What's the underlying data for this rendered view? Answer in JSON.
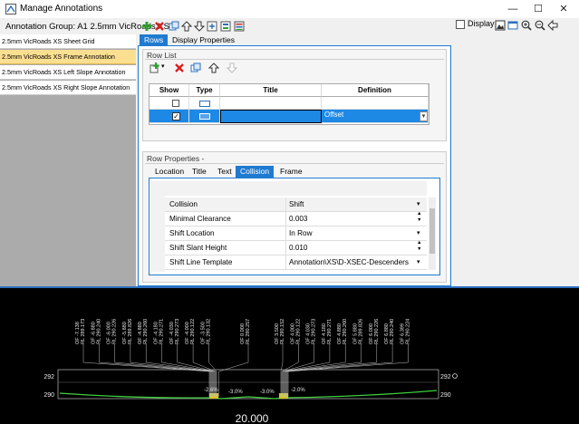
{
  "window": {
    "title": "Manage Annotations",
    "minimize": "—",
    "maximize": "☐",
    "close": "✕"
  },
  "toolbar": {
    "group_label": "Annotation Group: A1 2.5mm VicRoads XS"
  },
  "display": {
    "label": "Display"
  },
  "left_list": {
    "items": [
      {
        "label": "2.5mm VicRoads XS Sheet Grid",
        "selected": false
      },
      {
        "label": "2.5mm VicRoads XS Frame Annotation",
        "selected": true
      },
      {
        "label": "2.5mm VicRoads XS Left Slope Annotation",
        "selected": false
      },
      {
        "label": "2.5mm VicRoads XS Right Slope Annotation",
        "selected": false
      }
    ]
  },
  "tabs": [
    {
      "label": "Rows",
      "active": true
    },
    {
      "label": "Display Properties",
      "active": false
    }
  ],
  "row_list": {
    "title": "Row List",
    "columns": [
      "Show",
      "Type",
      "Title",
      "Definition"
    ],
    "rows": [
      {
        "show": false,
        "type": "empty",
        "title": "",
        "definition": ""
      },
      {
        "show": true,
        "type": "text",
        "title": "",
        "definition": "Offset",
        "selected": true
      }
    ]
  },
  "row_properties": {
    "title": "Row Properties -",
    "subtabs": [
      {
        "label": "Location",
        "active": false
      },
      {
        "label": "Title",
        "active": false
      },
      {
        "label": "Text",
        "active": false
      },
      {
        "label": "Collision",
        "active": true
      },
      {
        "label": "Frame",
        "active": false
      }
    ],
    "props": [
      {
        "name": "Collision",
        "value": "Shift",
        "control": "dropdown",
        "header": true
      },
      {
        "name": "Minimal Clearance",
        "value": "0.003",
        "control": "spin"
      },
      {
        "name": "Shift Location",
        "value": "In Row",
        "control": "dropdown"
      },
      {
        "name": "Shift Slant Height",
        "value": "0.010",
        "control": "spin"
      },
      {
        "name": "Shift Line Template",
        "value": "Annotation\\XS\\D-XSEC-Descenders",
        "control": "dropdown"
      }
    ]
  },
  "xsection": {
    "labels_left": [
      {
        "of": "OF -7.138",
        "rl": "RL 289.173"
      },
      {
        "of": "OF -6.880",
        "rl": "RL 290.240"
      },
      {
        "of": "OF -6.000",
        "rl": "RL 290.226"
      },
      {
        "of": "OF -5.880",
        "rl": "RL 289.826"
      },
      {
        "of": "OF -4.880",
        "rl": "RL 290.260"
      },
      {
        "of": "OF -4.180",
        "rl": "RL 290.271"
      },
      {
        "of": "OF -4.030",
        "rl": "RL 290.273"
      },
      {
        "of": "OF -4.000",
        "rl": "RL 290.122"
      },
      {
        "of": "OF -3.500",
        "rl": "RL 290.132"
      }
    ],
    "labels_center": [
      {
        "of": "OF 0.000",
        "rl": "RL 290.257"
      }
    ],
    "labels_right": [
      {
        "of": "OF 3.500",
        "rl": "RL 290.152"
      },
      {
        "of": "OF 4.000",
        "rl": "RL 290.122"
      },
      {
        "of": "OF 4.030",
        "rl": "RL 290.273"
      },
      {
        "of": "OF 4.180",
        "rl": "RL 290.271"
      },
      {
        "of": "OF 4.880",
        "rl": "RL 290.260"
      },
      {
        "of": "OF 5.880",
        "rl": "RL 289.826"
      },
      {
        "of": "OF 6.000",
        "rl": "RL 290.226"
      },
      {
        "of": "OF 6.880",
        "rl": "RL 290.240"
      },
      {
        "of": "OF 6.399",
        "rl": "RL 290.224"
      }
    ],
    "grades": [
      "-2.6%",
      "-3.0%",
      "-3.0%",
      "-2.0%"
    ],
    "y_axis": [
      "292",
      "290"
    ],
    "chainage": "20.000",
    "colors": {
      "ground": "#3fcf3f",
      "grid": "#bdbdbd",
      "text": "#e6e6e6",
      "accent": "#1f7ad0"
    }
  }
}
